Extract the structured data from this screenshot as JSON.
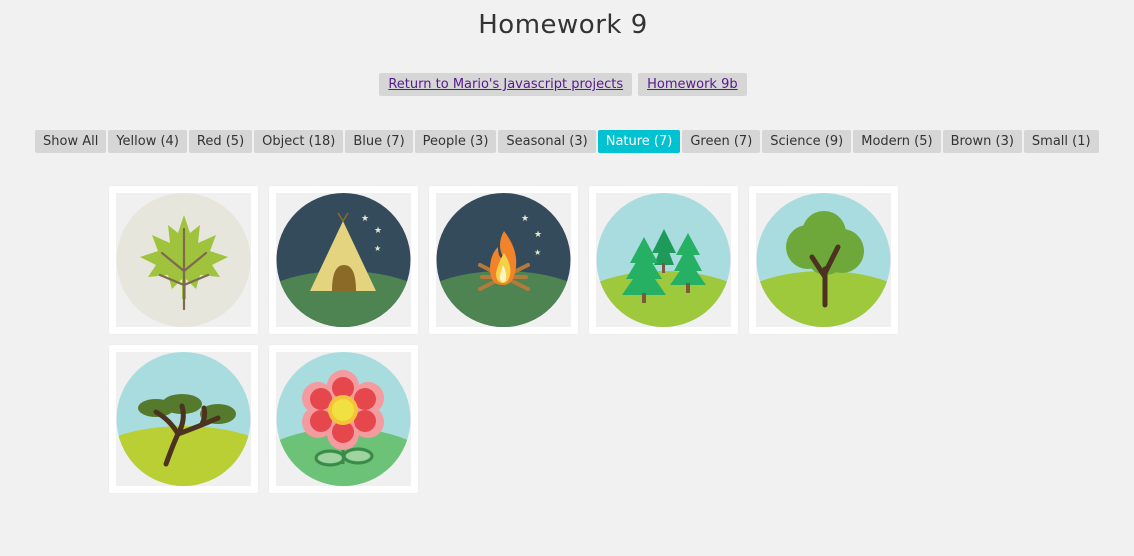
{
  "page": {
    "title": "Homework 9"
  },
  "links": [
    {
      "label": "Return to Mario's Javascript projects"
    },
    {
      "label": "Homework 9b"
    }
  ],
  "filters": [
    {
      "label": "Show All",
      "active": false
    },
    {
      "label": "Yellow (4)",
      "active": false
    },
    {
      "label": "Red (5)",
      "active": false
    },
    {
      "label": "Object (18)",
      "active": false
    },
    {
      "label": "Blue (7)",
      "active": false
    },
    {
      "label": "People (3)",
      "active": false
    },
    {
      "label": "Seasonal (3)",
      "active": false
    },
    {
      "label": "Nature (7)",
      "active": true
    },
    {
      "label": "Green (7)",
      "active": false
    },
    {
      "label": "Science (9)",
      "active": false
    },
    {
      "label": "Modern (5)",
      "active": false
    },
    {
      "label": "Brown (3)",
      "active": false
    },
    {
      "label": "Small (1)",
      "active": false
    }
  ],
  "gallery": {
    "items": [
      {
        "icon": "maple-leaf-icon"
      },
      {
        "icon": "tent-icon"
      },
      {
        "icon": "campfire-icon"
      },
      {
        "icon": "pine-trees-icon"
      },
      {
        "icon": "tree-icon"
      },
      {
        "icon": "acacia-tree-icon"
      },
      {
        "icon": "flower-icon"
      }
    ]
  },
  "colors": {
    "accent": "#00c2d1",
    "button_bg": "#d6d6d6",
    "page_bg": "#f1f1f1"
  }
}
